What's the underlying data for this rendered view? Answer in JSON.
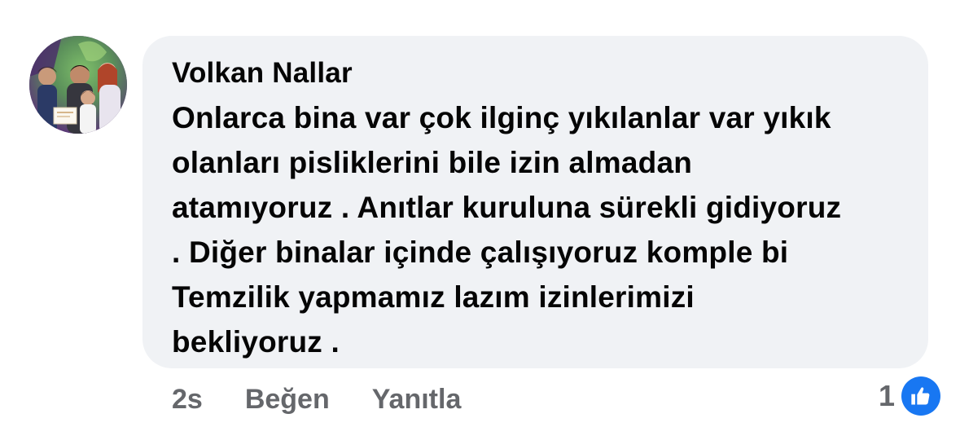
{
  "comment": {
    "author": "Volkan Nallar",
    "text": "Onlarca bina var çok ilginç yıkılanlar var yıkık\nolanları pisliklerini bile izin almadan\natamıyoruz . Anıtlar kuruluna sürekli gidiyoruz\n. Diğer binalar içinde çalışıyoruz komple bi\nTemzilik yapmamız lazım izinlerimizi\nbekliyoruz ."
  },
  "actions": {
    "time": "2s",
    "like_label": "Beğen",
    "reply_label": "Yanıtla"
  },
  "reactions": {
    "count": "1",
    "icon": "thumbs-up-icon"
  },
  "colors": {
    "bubble_bg": "#f0f2f5",
    "text": "#050505",
    "secondary_text": "#65676b",
    "like_blue": "#1877f2"
  }
}
